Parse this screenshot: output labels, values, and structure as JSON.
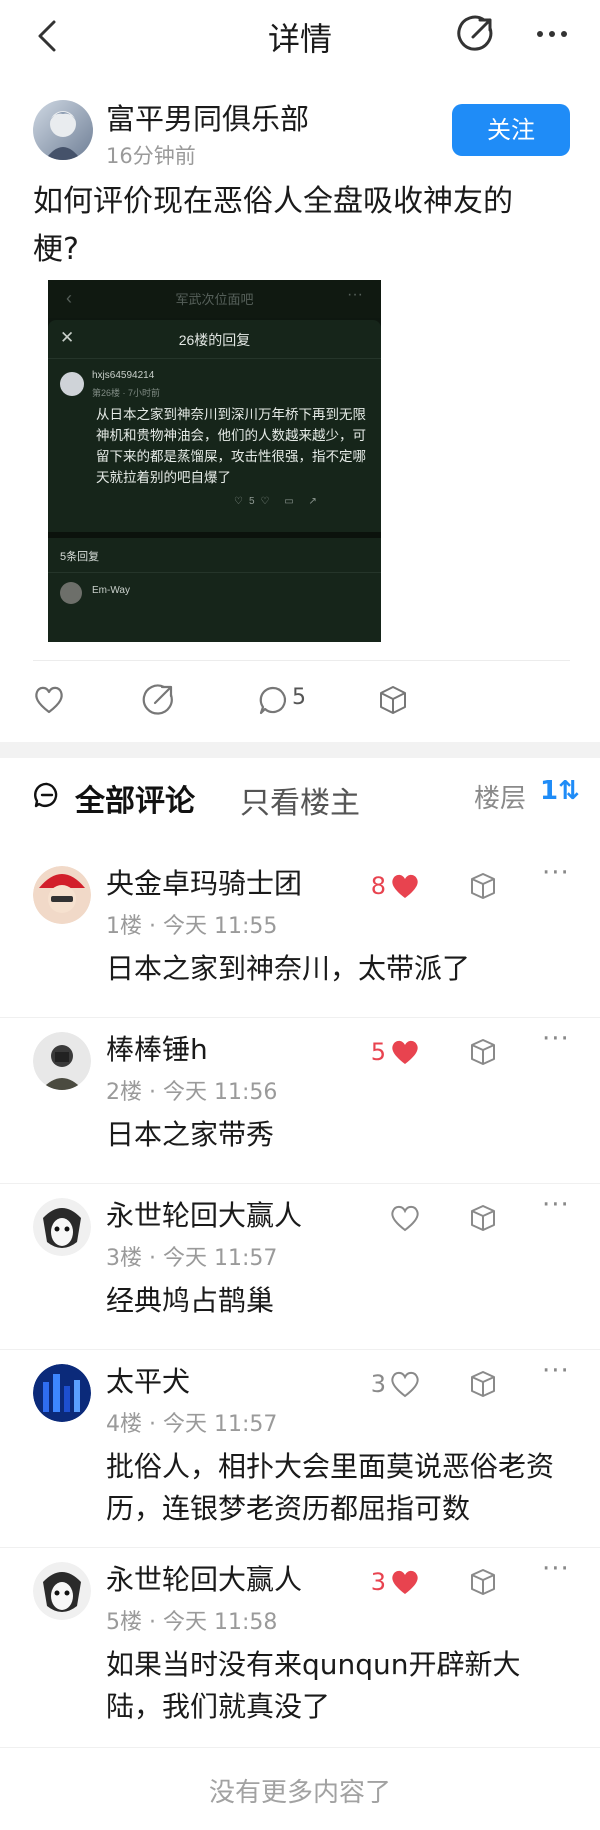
{
  "nav": {
    "title": "详情"
  },
  "post": {
    "author": "富平男同俱乐部",
    "time": "16分钟前",
    "follow_label": "关注",
    "title": "如何评价现在恶俗人全盘吸收神友的梗?",
    "comment_count": "5",
    "embedded_screenshot": {
      "top_title": "军武次位面吧",
      "sheet_title": "26楼的回复",
      "username": "hxjs64594214",
      "meta": "第26楼 · 7小时前",
      "text": "从日本之家到神奈川到深川万年桥下再到无限神机和贵物神油会，他们的人数越来越少，可留下来的都是蒸馏屎，攻击性很强，指不定哪天就拉着别的吧自爆了",
      "like_count": "5",
      "reply_count": "5条回复",
      "next_user": "Em-Way"
    }
  },
  "comments_header": {
    "all_label": "全部评论",
    "owner_only_label": "只看楼主",
    "floor_label": "楼层"
  },
  "comments": [
    {
      "name": "央金卓玛骑士团",
      "meta": "1楼 · 今天 11:55",
      "body": "日本之家到神奈川，太带派了",
      "likes": "8",
      "liked": true
    },
    {
      "name": "棒棒锤h",
      "meta": "2楼 · 今天 11:56",
      "body": "日本之家带秀",
      "likes": "5",
      "liked": true
    },
    {
      "name": "永世轮回大赢人",
      "meta": "3楼 · 今天 11:57",
      "body": "经典鸠占鹊巢",
      "likes": "",
      "liked": false
    },
    {
      "name": "太平犬",
      "meta": "4楼 · 今天 11:57",
      "body": "批俗人，相扑大会里面莫说恶俗老资历，连银梦老资历都屈指可数",
      "likes": "3",
      "liked": false
    },
    {
      "name": "永世轮回大赢人",
      "meta": "5楼 · 今天 11:58",
      "body": "如果当时没有来qunqun开辟新大陆，我们就真没了",
      "likes": "3",
      "liked": true
    }
  ],
  "footer": {
    "end_text": "没有更多内容了"
  },
  "colors": {
    "accent": "#1f8cf7",
    "liked": "#e8434f",
    "muted": "#9a9a9a"
  }
}
